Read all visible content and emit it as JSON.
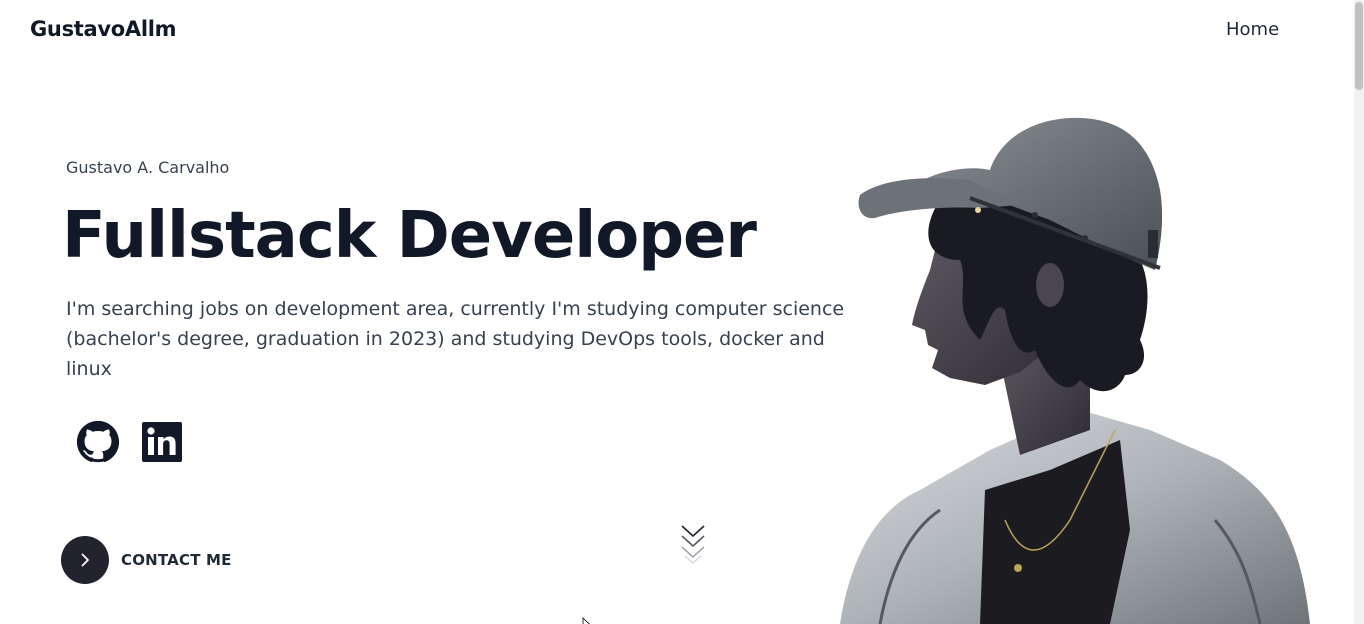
{
  "nav": {
    "brand": "GustavoAllm",
    "home_label": "Home"
  },
  "hero": {
    "subtitle": "Gustavo A. Carvalho",
    "headline": "Fullstack Developer",
    "description": "I'm searching jobs on development area, currently I'm studying computer science (bachelor's degree, graduation in 2023) and studying DevOps tools, docker and linux",
    "social": [
      {
        "icon": "github-icon"
      },
      {
        "icon": "linkedin-icon"
      }
    ],
    "contact_label": "CONTACT ME"
  },
  "colors": {
    "text_dark": "#111827",
    "button_dark": "#23232f",
    "background": "#ffffff"
  }
}
